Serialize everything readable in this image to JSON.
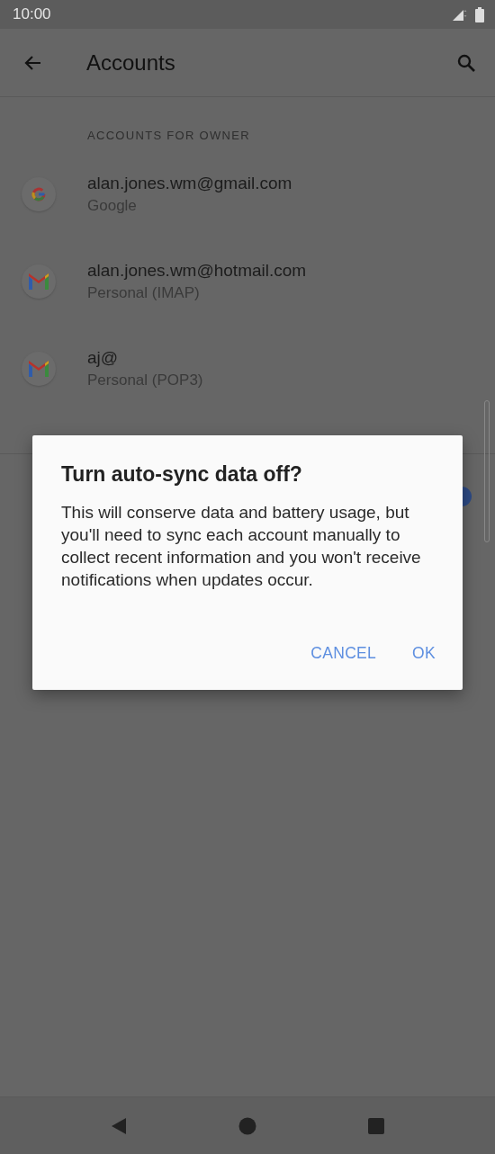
{
  "status_bar": {
    "time": "10:00"
  },
  "app_bar": {
    "title": "Accounts"
  },
  "section_header": "ACCOUNTS FOR OWNER",
  "accounts": [
    {
      "kind": "google",
      "email": "alan.jones.wm@gmail.com",
      "type": "Google"
    },
    {
      "kind": "gmail",
      "email": "alan.jones.wm@hotmail.com",
      "type": "Personal (IMAP)"
    },
    {
      "kind": "gmail",
      "email": "aj@",
      "type": "Personal (POP3)"
    }
  ],
  "auto_sync_switch": {
    "on": true
  },
  "dialog": {
    "title": "Turn auto-sync data off?",
    "message": "This will conserve data and battery usage, but you'll need to sync each account manually to collect recent information and you won't receive notifications when updates occur.",
    "buttons": [
      "CANCEL",
      "OK"
    ]
  }
}
